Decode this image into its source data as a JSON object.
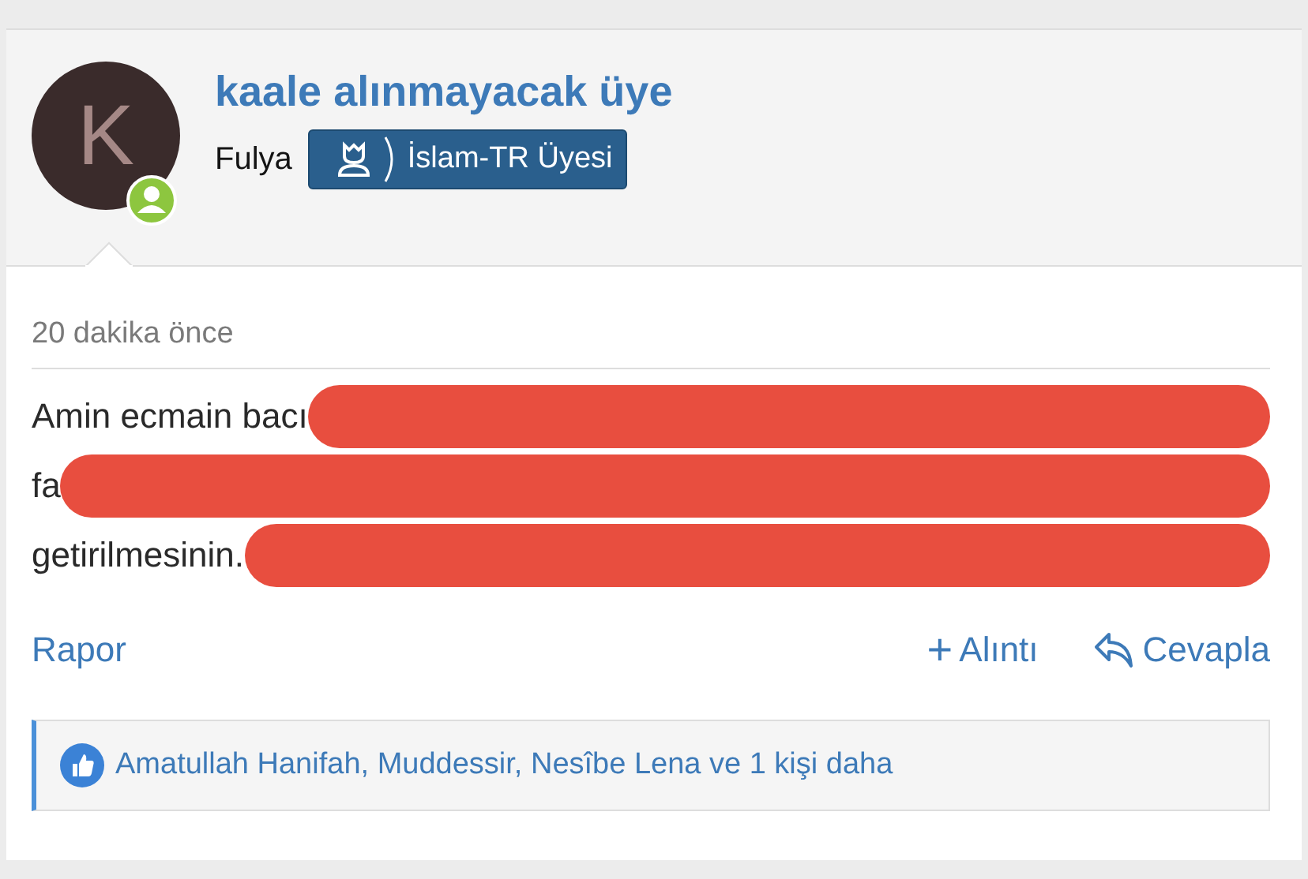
{
  "author": {
    "avatar_letter": "K",
    "title": "kaale alınmayacak üye",
    "name": "Fulya",
    "badge": "İslam-TR Üyesi",
    "online": true
  },
  "post": {
    "time": "20 dakika önce",
    "lines": [
      "Amin ecmain bacı",
      "fa",
      "getirilmesinin."
    ]
  },
  "actions": {
    "report": "Rapor",
    "quote": "+",
    "quote_label": "Alıntı",
    "reply": "Cevapla"
  },
  "likes": {
    "text": "Amatullah Hanifah, Muddessir, Nesîbe Lena ve 1 kişi daha"
  }
}
